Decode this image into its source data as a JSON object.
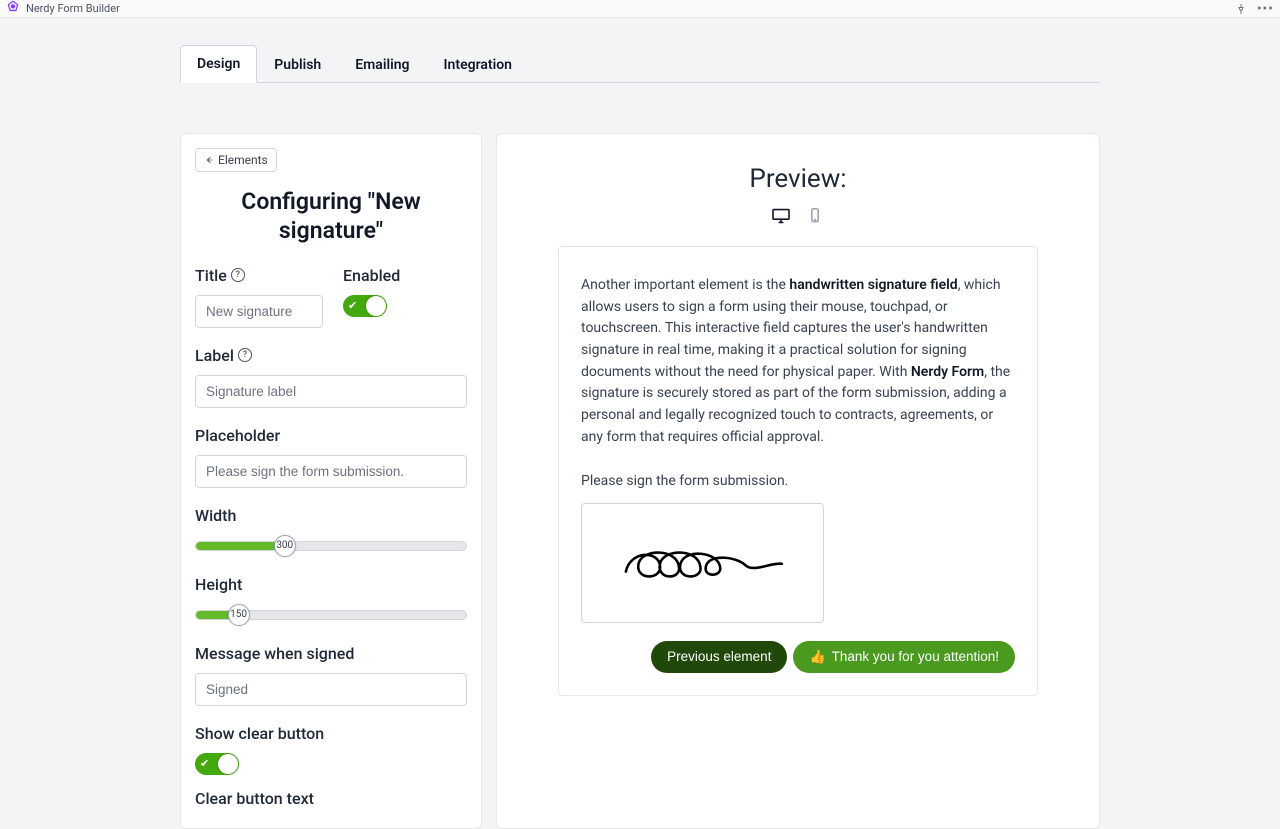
{
  "app": {
    "title": "Nerdy Form Builder"
  },
  "tabs": [
    "Design",
    "Publish",
    "Emailing",
    "Integration"
  ],
  "activeTab": 0,
  "config": {
    "backLabel": "Elements",
    "heading": "Configuring \"New signature\"",
    "fields": {
      "titleLabel": "Title",
      "titleValue": "New signature",
      "enabledLabel": "Enabled",
      "enabledValue": true,
      "labelLabel": "Label",
      "labelValue": "Signature label",
      "placeholderLabel": "Placeholder",
      "placeholderValue": "Please sign the form submission.",
      "widthLabel": "Width",
      "widthValue": 300,
      "widthMax": 900,
      "heightLabel": "Height",
      "heightValue": 150,
      "heightMax": 900,
      "msgLabel": "Message when signed",
      "msgValue": "Signed",
      "showClearLabel": "Show clear button",
      "showClearValue": true,
      "clearTextLabel": "Clear button text"
    }
  },
  "preview": {
    "heading": "Preview:",
    "desc_pre": "Another important element is the ",
    "desc_b1": "handwritten signature field",
    "desc_mid": ", which allows users to sign a form using their mouse, touchpad, or touchscreen. This interactive field captures the user's handwritten signature in real time, making it a practical solution for signing documents without the need for physical paper. With ",
    "desc_b2": "Nerdy Form",
    "desc_post": ", the signature is securely stored as part of the form submission, adding a personal and legally recognized touch to contracts, agreements, or any form that requires official approval.",
    "sigPlaceholder": "Please sign the form submission.",
    "prevBtn": "Previous element",
    "nextBtn": "Thank you for you attention!"
  },
  "colors": {
    "green": "#4a9a1f",
    "darkGreen": "#20480a",
    "sliderFill": "#64ba28"
  }
}
